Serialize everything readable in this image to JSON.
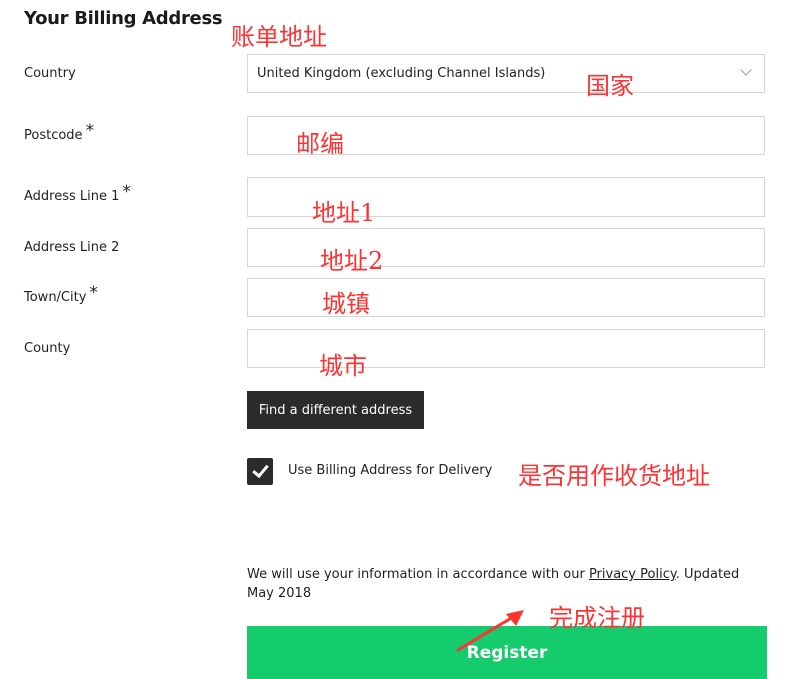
{
  "form": {
    "title": "Your Billing Address",
    "country": {
      "label": "Country",
      "value": "United Kingdom (excluding Channel Islands)"
    },
    "postcode": {
      "label": "Postcode",
      "required_mark": "*",
      "value": ""
    },
    "address1": {
      "label": "Address Line 1",
      "required_mark": "*",
      "value": ""
    },
    "address2": {
      "label": "Address Line 2",
      "value": ""
    },
    "town": {
      "label": "Town/City",
      "required_mark": "*",
      "value": ""
    },
    "county": {
      "label": "County",
      "value": ""
    },
    "find_button": "Find a different address",
    "use_for_delivery": {
      "label": "Use Billing Address for Delivery",
      "checked": true
    },
    "privacy": {
      "before": "We will use your information in accordance with our ",
      "link": "Privacy Policy",
      "after": ". Updated May 2018"
    },
    "register_button": "Register"
  },
  "annotations": {
    "billing_address": "账单地址",
    "country": "国家",
    "postcode": "邮编",
    "address1": "地址1",
    "address2": "地址2",
    "town": "城镇",
    "county": "城市",
    "use_as_delivery": "是否用作收货地址",
    "complete_registration": "完成注册"
  },
  "colors": {
    "primary_button": "#15cc6c",
    "dark_button": "#2b2b2b",
    "annotation": "#ff3333"
  }
}
